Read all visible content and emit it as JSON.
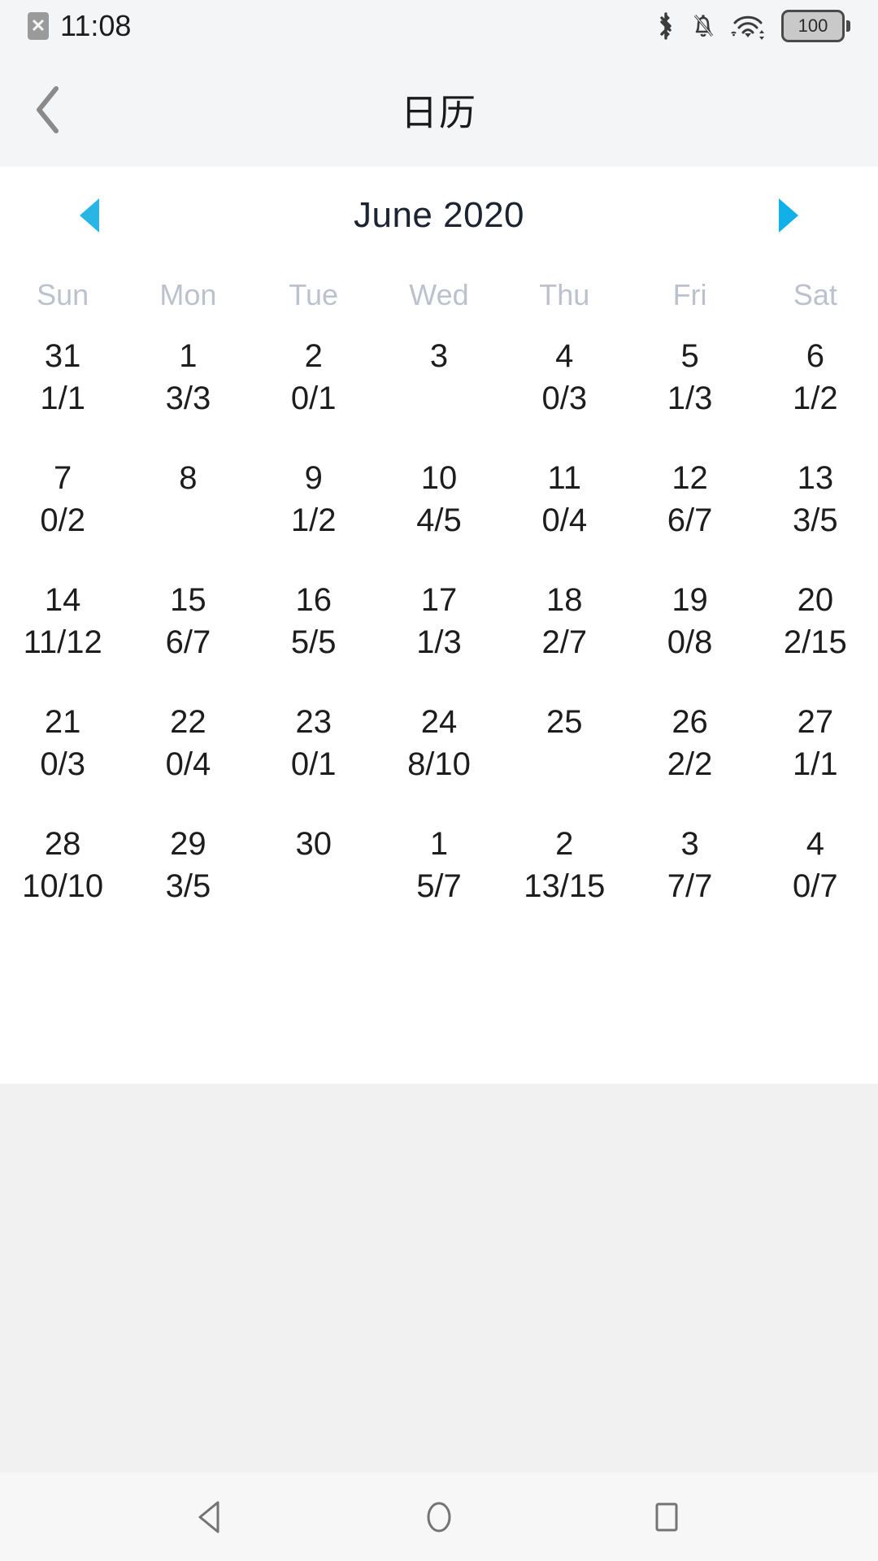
{
  "status_bar": {
    "sim_icon": "sim-x-icon",
    "time": "11:08",
    "icons": [
      "bluetooth-icon",
      "notifications-muted-icon",
      "wifi-icon"
    ],
    "battery_level": "100"
  },
  "header": {
    "back_icon": "chevron-left-icon",
    "title": "日历"
  },
  "calendar": {
    "prev_icon": "triangle-left-icon",
    "next_icon": "triangle-right-icon",
    "month_label": "June 2020",
    "accent_color": "#19b2e6",
    "weekdays": [
      "Sun",
      "Mon",
      "Tue",
      "Wed",
      "Thu",
      "Fri",
      "Sat"
    ],
    "weeks": [
      [
        {
          "day": "31",
          "sub": "1/1"
        },
        {
          "day": "1",
          "sub": "3/3"
        },
        {
          "day": "2",
          "sub": "0/1"
        },
        {
          "day": "3",
          "sub": ""
        },
        {
          "day": "4",
          "sub": "0/3"
        },
        {
          "day": "5",
          "sub": "1/3"
        },
        {
          "day": "6",
          "sub": "1/2"
        }
      ],
      [
        {
          "day": "7",
          "sub": "0/2"
        },
        {
          "day": "8",
          "sub": ""
        },
        {
          "day": "9",
          "sub": "1/2"
        },
        {
          "day": "10",
          "sub": "4/5"
        },
        {
          "day": "11",
          "sub": "0/4"
        },
        {
          "day": "12",
          "sub": "6/7"
        },
        {
          "day": "13",
          "sub": "3/5"
        }
      ],
      [
        {
          "day": "14",
          "sub": "11/12"
        },
        {
          "day": "15",
          "sub": "6/7"
        },
        {
          "day": "16",
          "sub": "5/5"
        },
        {
          "day": "17",
          "sub": "1/3"
        },
        {
          "day": "18",
          "sub": "2/7"
        },
        {
          "day": "19",
          "sub": "0/8"
        },
        {
          "day": "20",
          "sub": "2/15"
        }
      ],
      [
        {
          "day": "21",
          "sub": "0/3"
        },
        {
          "day": "22",
          "sub": "0/4"
        },
        {
          "day": "23",
          "sub": "0/1"
        },
        {
          "day": "24",
          "sub": "8/10"
        },
        {
          "day": "25",
          "sub": ""
        },
        {
          "day": "26",
          "sub": "2/2"
        },
        {
          "day": "27",
          "sub": "1/1"
        }
      ],
      [
        {
          "day": "28",
          "sub": "10/10"
        },
        {
          "day": "29",
          "sub": "3/5"
        },
        {
          "day": "30",
          "sub": ""
        },
        {
          "day": "1",
          "sub": "5/7"
        },
        {
          "day": "2",
          "sub": "13/15"
        },
        {
          "day": "3",
          "sub": "7/7"
        },
        {
          "day": "4",
          "sub": "0/7"
        }
      ]
    ]
  },
  "nav_bar": {
    "back": "nav-back-icon",
    "home": "nav-home-icon",
    "recents": "nav-recents-icon"
  }
}
